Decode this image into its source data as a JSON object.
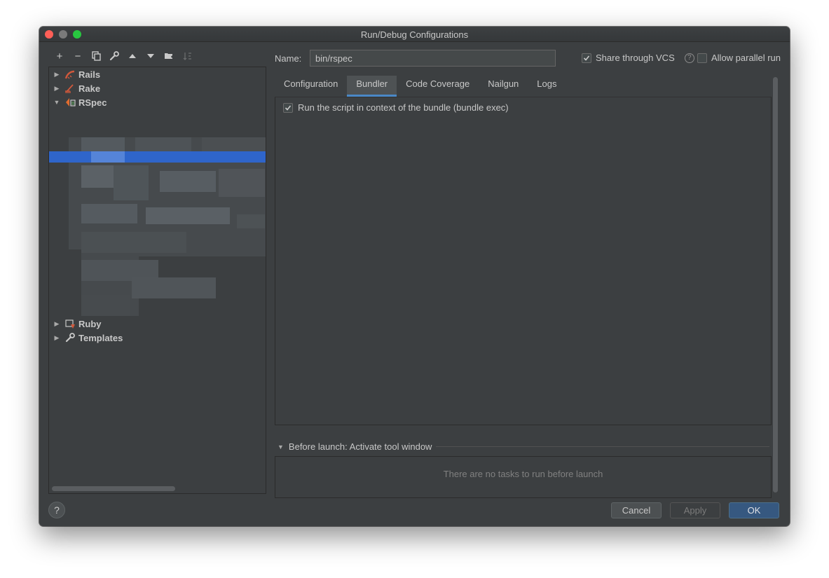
{
  "window": {
    "title": "Run/Debug Configurations"
  },
  "toolbar": {
    "add": "+",
    "remove": "−"
  },
  "tree": {
    "items": [
      {
        "label": "Rails",
        "icon": "rails-icon"
      },
      {
        "label": "Rake",
        "icon": "rake-icon"
      },
      {
        "label": "RSpec",
        "icon": "rspec-icon"
      },
      {
        "label": "Ruby",
        "icon": "ruby-icon"
      },
      {
        "label": "Templates",
        "icon": "wrench-icon"
      }
    ]
  },
  "config": {
    "name_label": "Name:",
    "name_value": "bin/rspec",
    "share_label": "Share through VCS",
    "share_help": "?",
    "parallel_label": "Allow parallel run"
  },
  "tabs": [
    {
      "label": "Configuration"
    },
    {
      "label": "Bundler"
    },
    {
      "label": "Code Coverage"
    },
    {
      "label": "Nailgun"
    },
    {
      "label": "Logs"
    }
  ],
  "bundler": {
    "option_label": "Run the script in context of the bundle (bundle exec)",
    "option_checked": true
  },
  "before_launch": {
    "title": "Before launch: Activate tool window",
    "empty": "There are no tasks to run before launch"
  },
  "footer": {
    "help": "?",
    "cancel": "Cancel",
    "apply": "Apply",
    "ok": "OK"
  },
  "colors": {
    "background": "#3c3f41",
    "selection": "#2f65ca",
    "accent": "#4a88c7",
    "ok_button": "#365880"
  }
}
